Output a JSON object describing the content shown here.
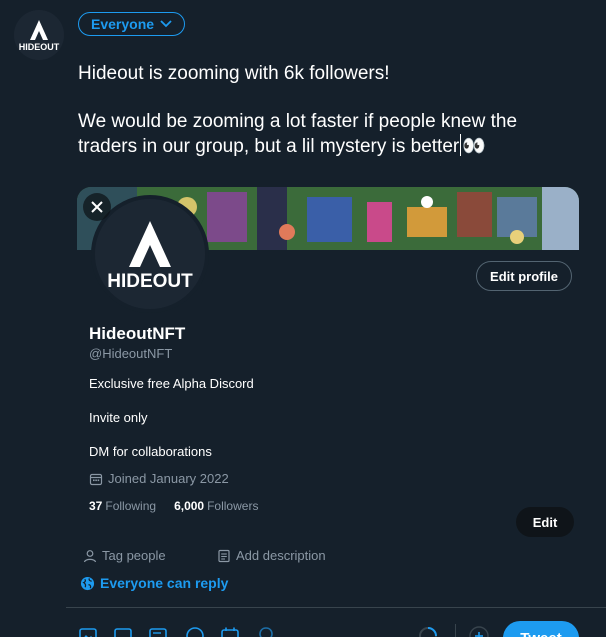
{
  "composer": {
    "audience_label": "Everyone",
    "tweet_line1": "Hideout is zooming with 6k followers!",
    "tweet_line2_a": "We would be zooming a lot faster if people knew the traders in our group, but a lil mystery is better",
    "tweet_emoji": "👀"
  },
  "logo": {
    "text": "HIDEOUT"
  },
  "profile": {
    "name": "HideoutNFT",
    "handle": "@HideoutNFT",
    "bio": [
      "Exclusive free Alpha Discord",
      "Invite only",
      "DM for collaborations"
    ],
    "joined": "Joined January 2022",
    "following_count": "37",
    "following_label": "Following",
    "followers_count": "6,000",
    "followers_label": "Followers",
    "edit_profile_label": "Edit profile",
    "edit_label": "Edit"
  },
  "options": {
    "tag_people": "Tag people",
    "add_description": "Add description",
    "reply_setting": "Everyone can reply"
  },
  "toolbar": {
    "tweet_label": "Tweet"
  },
  "colors": {
    "accent": "#1d9bf0",
    "background": "#15202b",
    "muted": "#8b98a5"
  }
}
